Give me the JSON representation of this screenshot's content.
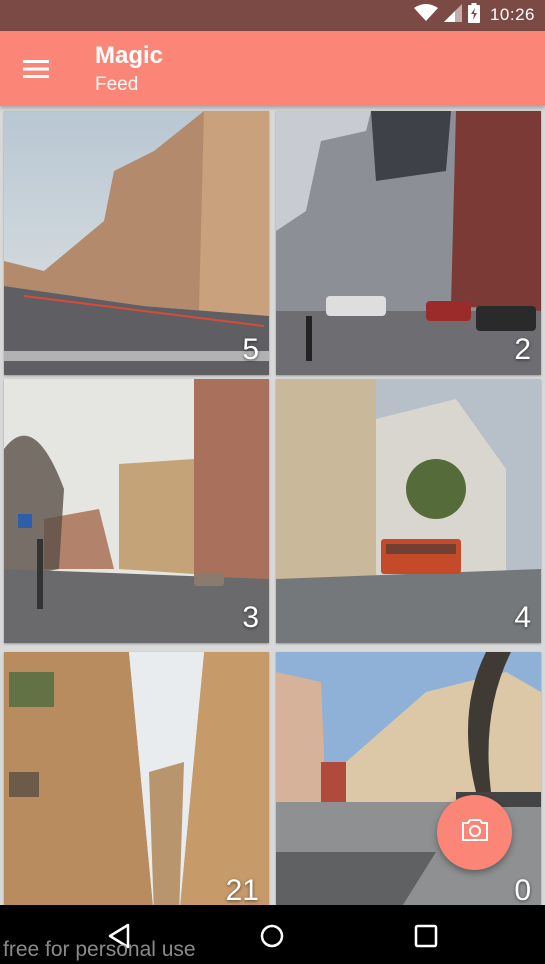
{
  "status_bar": {
    "time": "10:26",
    "icons": [
      "wifi-icon",
      "cell-signal-icon",
      "battery-icon"
    ]
  },
  "app_bar": {
    "title": "Magic",
    "subtitle": "Feed",
    "menu_icon": "hamburger-menu-icon",
    "background": "#fb8677"
  },
  "feed": {
    "items": [
      {
        "count": "5",
        "scene": "street-perspective-evening"
      },
      {
        "count": "2",
        "scene": "busy-street-with-cars"
      },
      {
        "count": "3",
        "scene": "winter-street-corner"
      },
      {
        "count": "4",
        "scene": "street-with-tram"
      },
      {
        "count": "21",
        "scene": "narrow-alley-buildings"
      },
      {
        "count": "0",
        "scene": "square-with-tree"
      }
    ]
  },
  "fab": {
    "icon": "camera-icon",
    "color": "#fb8677"
  },
  "nav_bar": {
    "icons": [
      "back-icon",
      "home-icon",
      "recents-icon"
    ]
  },
  "watermark": "free for personal use"
}
